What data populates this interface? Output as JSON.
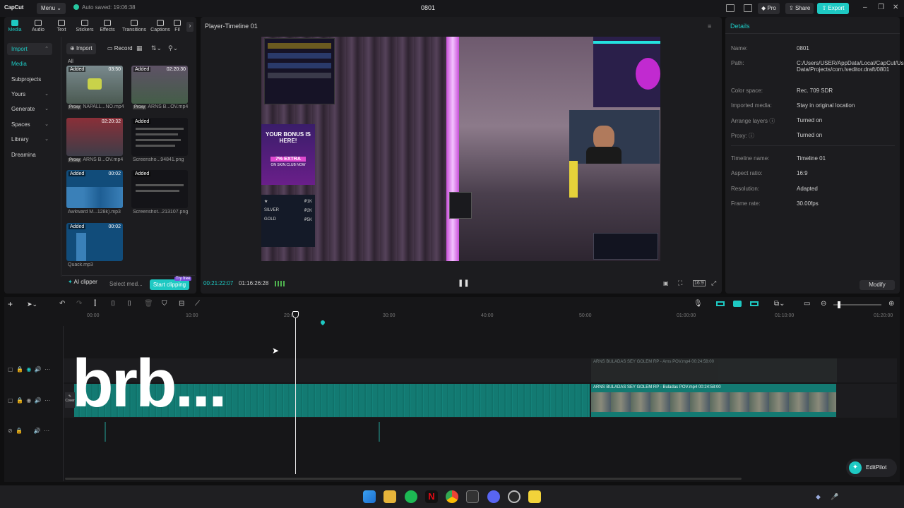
{
  "app": {
    "logo": "CapCut",
    "menu_label": "Menu ⌄",
    "autosave": "Auto saved: 19:06:38",
    "title": "0801",
    "pro_label": "Pro",
    "share_label": "Share",
    "export_label": "Export"
  },
  "top_tabs": [
    {
      "label": "Media",
      "icon": "media-icon"
    },
    {
      "label": "Audio",
      "icon": "audio-icon"
    },
    {
      "label": "Text",
      "icon": "text-icon"
    },
    {
      "label": "Stickers",
      "icon": "stickers-icon"
    },
    {
      "label": "Effects",
      "icon": "effects-icon"
    },
    {
      "label": "Transitions",
      "icon": "transitions-icon"
    },
    {
      "label": "Captions",
      "icon": "captions-icon"
    },
    {
      "label": "Fil",
      "icon": "filters-icon"
    }
  ],
  "sidebar": {
    "items": [
      "Import",
      "Media",
      "Subprojects",
      "Yours",
      "Generate",
      "Spaces",
      "Library",
      "Dreamina"
    ]
  },
  "media_toolbar": {
    "import": "Import",
    "record": "Record",
    "filter_all": "All"
  },
  "media_tiles": [
    {
      "status": "Added",
      "duration": "03:50",
      "name": "NAPALL...NO.mp4",
      "proxy": "Proxy"
    },
    {
      "status": "Added",
      "duration": "02:20:30",
      "name": "ARNS B...OV.mp4",
      "proxy": "Proxy"
    },
    {
      "status": "Added",
      "duration": "02:20:32",
      "name": "ARNS B...OV.mp4",
      "proxy": "Proxy"
    },
    {
      "status": "Added",
      "duration": "",
      "name": "Screensho...94841.png",
      "proxy": ""
    },
    {
      "status": "Added",
      "duration": "00:02",
      "name": "Awkward M...128k).mp3",
      "proxy": ""
    },
    {
      "status": "Added",
      "duration": "",
      "name": "Screenshot...213107.png",
      "proxy": ""
    },
    {
      "status": "Added",
      "duration": "00:02",
      "name": "Quack.mp3",
      "proxy": ""
    }
  ],
  "media_bottom": {
    "ai_clipper": "AI clipper",
    "select_media": "Select med...",
    "start_clipping": "Start clipping",
    "try_free": "Try free"
  },
  "player": {
    "title": "Player-Timeline 01",
    "current_time": "00:21:22:07",
    "total_time": "01:16:26:28",
    "overlay": {
      "ad_title": "YOUR BONUS IS HERE!",
      "ad_extra": "7% EXTRA",
      "ad_site": "ON SKIN.CLUB NOW",
      "tiers": [
        "SILVER",
        "GOLD"
      ],
      "tier_values": [
        "₽2K",
        "₽5K"
      ],
      "bronze": "₽1K"
    }
  },
  "details": {
    "title": "Details",
    "rows": [
      {
        "k": "Name:",
        "v": "0801"
      },
      {
        "k": "Path:",
        "v": "C:/Users/USER/AppData/Local/CapCut/User Data/Projects/com.lveditor.draft/0801"
      },
      {
        "k": "Color space:",
        "v": "Rec. 709 SDR"
      },
      {
        "k": "Imported media:",
        "v": "Stay in original location"
      },
      {
        "k": "Arrange layers",
        "v": "Turned on"
      },
      {
        "k": "Proxy:",
        "v": "Turned on"
      },
      {
        "k": "Timeline name:",
        "v": "Timeline 01"
      },
      {
        "k": "Aspect ratio:",
        "v": "16:9"
      },
      {
        "k": "Resolution:",
        "v": "Adapted"
      },
      {
        "k": "Frame rate:",
        "v": "30.00fps"
      }
    ],
    "modify": "Modify"
  },
  "timeline": {
    "ruler": [
      "00:00",
      "10:00",
      "20:00",
      "30:00",
      "40:00",
      "50:00",
      "01:00:00",
      "01:10:00",
      "01:20:00"
    ],
    "clip_label_top": "ARNS BULADAS SEY GOLEM RP - Arns POV.mp4   00:24:58:00",
    "clip_label_main": "ARNS BULADAS SEY GOLEM RP - Buladas  POV.mp4   00:24:58:00",
    "cover_label": "Cover",
    "overlay_text": "brb..."
  },
  "editpilot": "EditPilot",
  "colors": {
    "accent": "#1ec9c3",
    "clip": "#137a72"
  }
}
